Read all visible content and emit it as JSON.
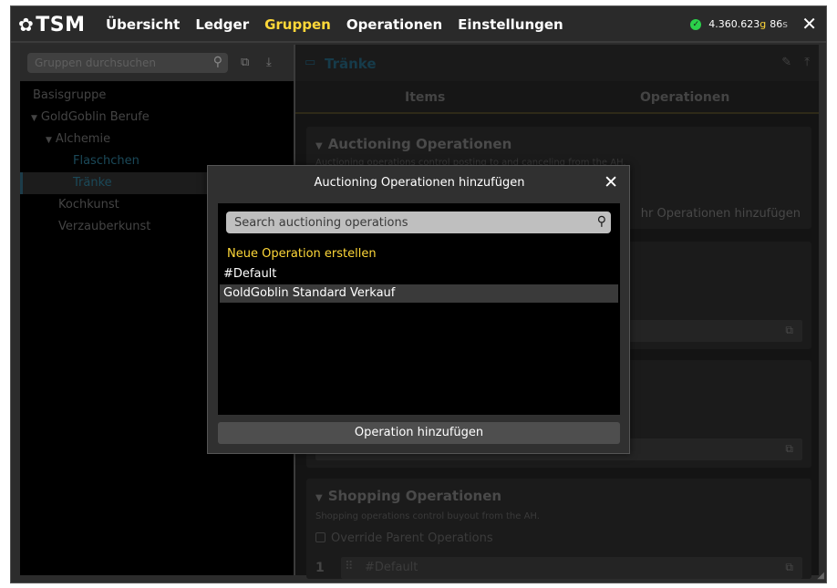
{
  "header": {
    "logo_text": "TSM",
    "nav": [
      "Übersicht",
      "Ledger",
      "Gruppen",
      "Operationen",
      "Einstellungen"
    ],
    "active_nav": "Gruppen",
    "gold_amount": "4.360.623",
    "gold_unit": "g",
    "silver_amount": "86",
    "silver_unit": "s",
    "close_glyph": "✕"
  },
  "left": {
    "search_placeholder": "Gruppen durchsuchen",
    "tree": [
      {
        "label": "Basisgruppe",
        "level": 0,
        "toggle": ""
      },
      {
        "label": "GoldGoblin Berufe",
        "level": 0,
        "toggle": "▼"
      },
      {
        "label": "Alchemie",
        "level": 1,
        "toggle": "▼"
      },
      {
        "label": "Flaschchen",
        "level": 2,
        "toggle": ""
      },
      {
        "label": "Tränke",
        "level": 2,
        "toggle": ""
      },
      {
        "label": "Kochkunst",
        "level": 1,
        "toggle": ""
      },
      {
        "label": "Verzauberkunst",
        "level": 1,
        "toggle": ""
      }
    ]
  },
  "right": {
    "title": "Tränke",
    "tabs": [
      "Items",
      "Operationen"
    ],
    "auctioning": {
      "title": "Auctioning Operationen",
      "subtitle": "Auctioning operations control posting to and canceling from the AH.",
      "add_more": "hr Operationen hinzufügen"
    },
    "shopping": {
      "title": "Shopping Operationen",
      "subtitle": "Shopping operations control buyout from the AH.",
      "override": "Override Parent Operations",
      "row_index": "1",
      "row_value": "#Default"
    }
  },
  "modal": {
    "title": "Auctioning Operationen hinzufügen",
    "search_placeholder": "Search auctioning operations",
    "new_operation": "Neue Operation erstellen",
    "items": [
      "#Default",
      "GoldGoblin Standard Verkauf"
    ],
    "highlighted_item": "GoldGoblin Standard Verkauf",
    "button_label": "Operation hinzufügen"
  },
  "colors": {
    "accent_gold": "#ffd839",
    "ok_green": "#2bd14a",
    "window_bg": "#2c2c2c",
    "panel_bg": "#000000"
  },
  "icons": [
    "gear-icon",
    "search-icon",
    "copy-icon",
    "import-icon",
    "folder-icon",
    "edit-icon",
    "export-icon",
    "external-link-icon",
    "drag-handle-icon",
    "close-icon",
    "check-circle-icon",
    "resize-grip-icon"
  ]
}
